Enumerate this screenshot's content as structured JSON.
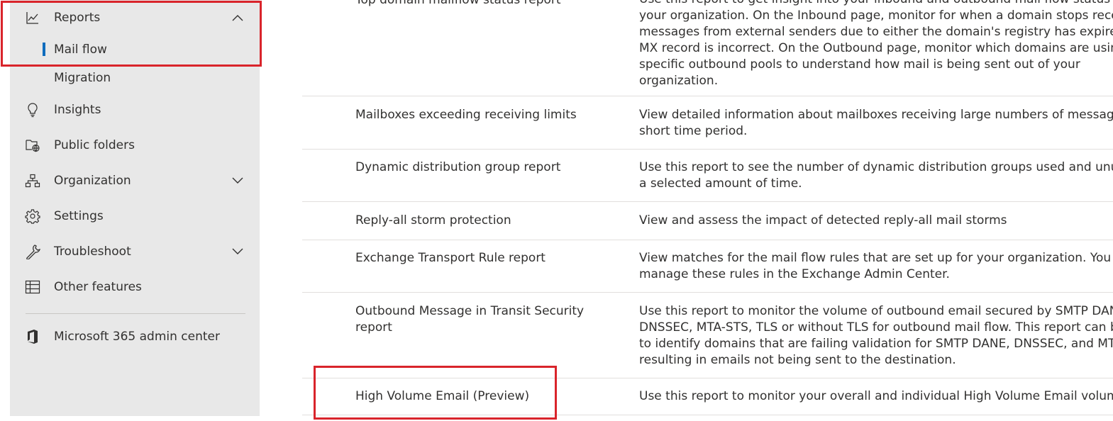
{
  "sidebar": {
    "reports": {
      "label": "Reports",
      "icon": "chart-line-icon"
    },
    "mail_flow": {
      "label": "Mail flow"
    },
    "migration": {
      "label": "Migration"
    },
    "insights": {
      "label": "Insights",
      "icon": "lightbulb-icon"
    },
    "public_folders": {
      "label": "Public folders",
      "icon": "folder-globe-icon"
    },
    "organization": {
      "label": "Organization",
      "icon": "org-chart-icon"
    },
    "settings": {
      "label": "Settings",
      "icon": "gear-icon"
    },
    "troubleshoot": {
      "label": "Troubleshoot",
      "icon": "wrench-icon"
    },
    "other_features": {
      "label": "Other features",
      "icon": "table-icon"
    },
    "m365": {
      "label": "Microsoft 365 admin center",
      "icon": "office-logo-icon"
    }
  },
  "reports": [
    {
      "name": "Top domain mailflow status report",
      "desc": [
        "Use this report to get insight into your inbound and outbound mail flow status for",
        "your organization. On the Inbound page, monitor for when a domain stops receiving",
        "messages from external senders due to either the domain's registry has expired, or the",
        "MX record is incorrect. On the Outbound page, monitor which domains are using",
        "specific outbound pools to understand how mail is being sent out of your",
        "organization."
      ]
    },
    {
      "name": "Mailboxes exceeding receiving limits",
      "desc": [
        "View detailed information about mailboxes receiving large numbers of messages in a",
        "short time period."
      ]
    },
    {
      "name": "Dynamic distribution group report",
      "desc": [
        "Use this report to see the number of dynamic distribution groups used and unused in",
        "a selected amount of time."
      ]
    },
    {
      "name": "Reply-all storm protection",
      "desc": [
        "View and assess the impact of detected reply-all mail storms"
      ]
    },
    {
      "name": "Exchange Transport Rule report",
      "desc": [
        "View matches for the mail flow rules that are set up for your organization. You can",
        "manage these rules in the Exchange Admin Center."
      ]
    },
    {
      "name": "Outbound Message in Transit Security report",
      "desc": [
        "Use this report to monitor the volume of outbound email secured by SMTP DANE with",
        "DNSSEC, MTA-STS, TLS or without TLS for outbound mail flow. This report can be used",
        "to identify domains that are failing validation for SMTP DANE, DNSSEC, and MTA-STS",
        "resulting in emails not being sent to the destination."
      ]
    },
    {
      "name": "High Volume Email (Preview)",
      "desc": [
        "Use this report to monitor your overall and individual High Volume Email volume."
      ]
    }
  ],
  "colors": {
    "accent": "#0f6cbd",
    "highlight": "#d9242b",
    "sidebar_bg": "#e8e8e8"
  }
}
